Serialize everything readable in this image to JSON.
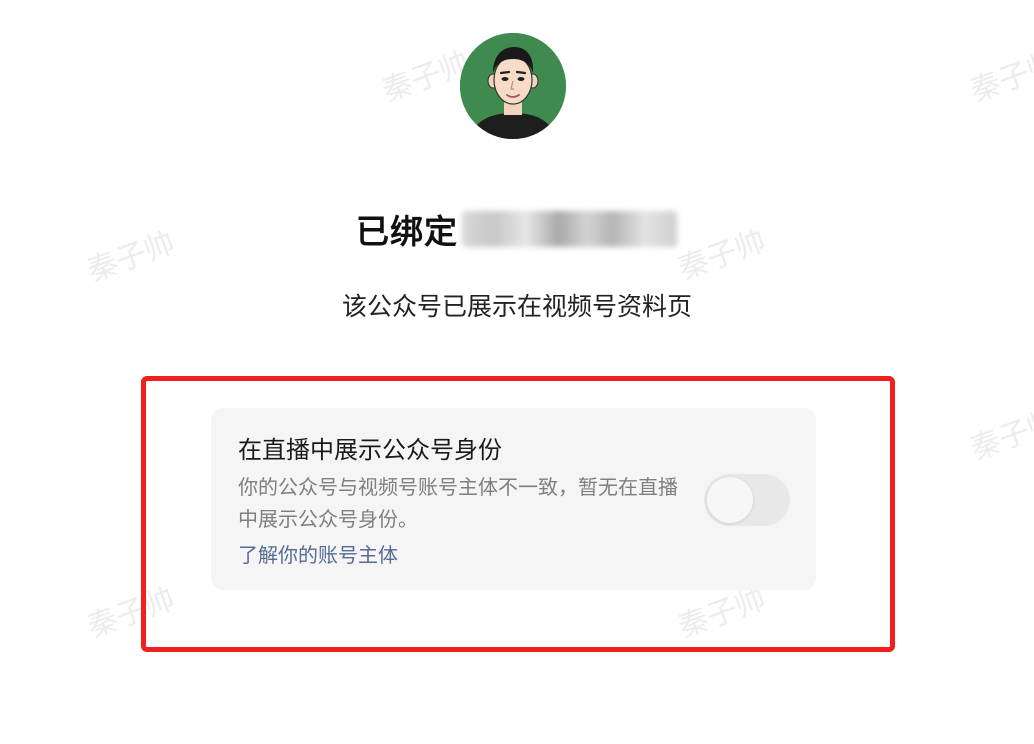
{
  "profile": {
    "avatar_icon": "cartoon-man-avatar",
    "bound_label": "已绑定",
    "bound_name_redacted": true
  },
  "subtitle": "该公众号已展示在视频号资料页",
  "live_identity_card": {
    "title": "在直播中展示公众号身份",
    "description": "你的公众号与视频号账号主体不一致，暂无在直播中展示公众号身份。",
    "link_label": "了解你的账号主体",
    "toggle_on": false
  },
  "watermark": {
    "text": "秦子帅"
  },
  "colors": {
    "highlight_border": "#f0201e",
    "link": "#576b95",
    "card_bg": "#f5f5f5",
    "avatar_bg": "#3f8a4f"
  }
}
